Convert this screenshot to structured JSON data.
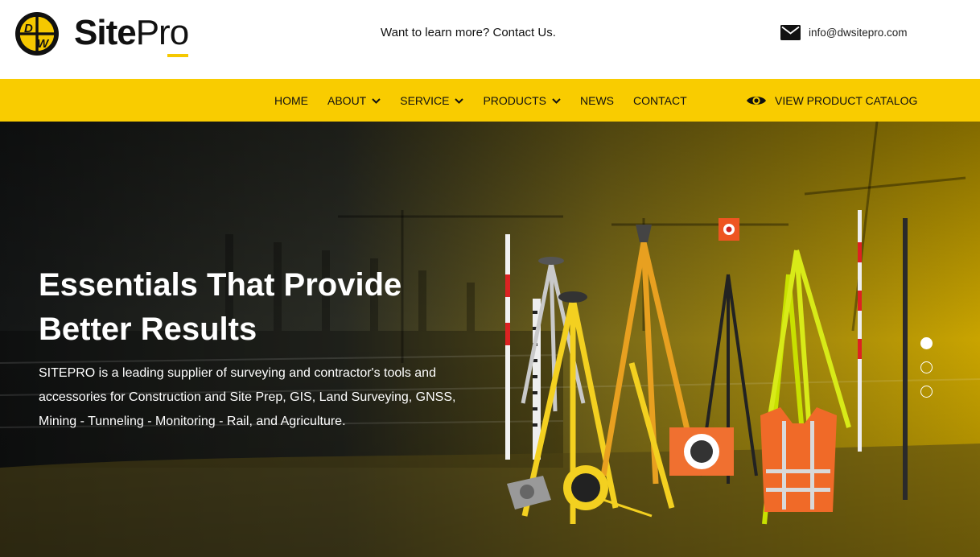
{
  "brand": {
    "badge_text": "DW",
    "name_bold": "Site",
    "name_light": "Pro",
    "colors": {
      "accent": "#f9cc00",
      "dark": "#111111"
    }
  },
  "header": {
    "tagline": "Want to learn more? Contact Us.",
    "email": "info@dwsitepro.com",
    "email_icon": "envelope-icon"
  },
  "nav": {
    "items": [
      {
        "label": "HOME",
        "has_dropdown": false
      },
      {
        "label": "ABOUT",
        "has_dropdown": true
      },
      {
        "label": "SERVICE",
        "has_dropdown": true
      },
      {
        "label": "PRODUCTS",
        "has_dropdown": true
      },
      {
        "label": "NEWS",
        "has_dropdown": false
      },
      {
        "label": "CONTACT",
        "has_dropdown": false
      }
    ],
    "catalog_label": "VIEW PRODUCT CATALOG",
    "catalog_icon": "eye-icon"
  },
  "hero": {
    "title_line1": "Essentials That Provide",
    "title_line2": "Better Results",
    "body": "SITEPRO is a leading supplier of surveying and contractor's tools and accessories for Construction and Site Prep, GIS, Land Surveying, GNSS, Mining - Tunneling - Monitoring - Rail, and Agriculture.",
    "slides": {
      "count": 3,
      "active": 1
    }
  }
}
